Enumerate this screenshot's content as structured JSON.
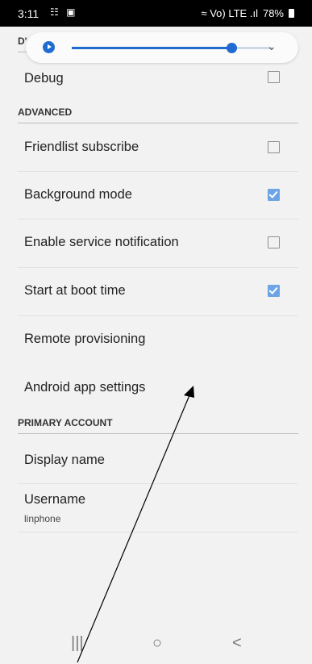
{
  "status_bar": {
    "time": "3:11",
    "status_icons": "☷ ▣",
    "signal_text": "≈ Vo) LTE .ıl",
    "battery": "78%"
  },
  "media": {
    "progress": 0.8
  },
  "sections": {
    "debug_partial": "D'ebug",
    "advanced": "ADVANCED",
    "primary_account": "PRIMARY ACCOUNT"
  },
  "settings": {
    "debug": {
      "label": "Debug",
      "checked": false
    },
    "friendlist": {
      "label": "Friendlist subscribe",
      "checked": false
    },
    "background": {
      "label": "Background mode",
      "checked": true
    },
    "service_notification": {
      "label": "Enable service notification",
      "checked": false
    },
    "start_boot": {
      "label": "Start at boot time",
      "checked": true
    },
    "remote_provisioning": {
      "label": "Remote provisioning"
    },
    "android_app_settings": {
      "label": "Android app settings"
    }
  },
  "account": {
    "display_name": {
      "label": "Display name"
    },
    "username": {
      "label": "Username",
      "value": "linphone"
    }
  },
  "nav": {
    "recents": "|||",
    "home": "○",
    "back": "<"
  },
  "colors": {
    "accent": "#1f6bd1",
    "checkbox_checked": "#6da5e4"
  }
}
